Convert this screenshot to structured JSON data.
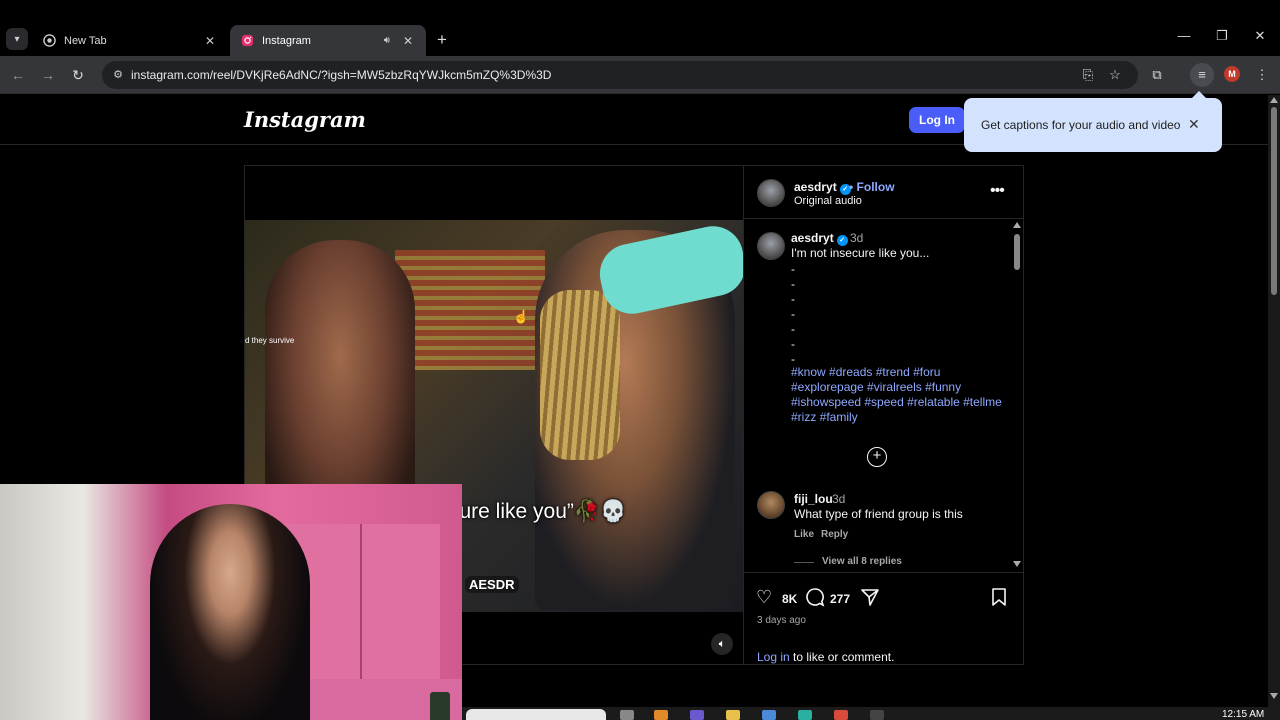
{
  "browser": {
    "tabs": [
      {
        "title": "New Tab",
        "icon": "chrome-icon",
        "active": false
      },
      {
        "title": "Instagram",
        "icon": "instagram-icon",
        "active": true
      }
    ],
    "url": "instagram.com/reel/DVKjRe6AdNC/?igsh=MW5zbzRqYWJkcm5mZQ%3D%3D",
    "profile_initial": "M",
    "profile_color": "#c0392b"
  },
  "captions_popup": {
    "message": "Get captions for your audio and video"
  },
  "instagram": {
    "logo": "Instagram",
    "login_button": "Log In",
    "accent": "#4a5df9"
  },
  "video": {
    "small_caption": "d they survive",
    "subtitle": "“Not Insecure like you”🥀💀",
    "watermark": "AESDR"
  },
  "post": {
    "username": "aesdryt",
    "follow": "Follow",
    "audio": "Original audio",
    "caption": {
      "username": "aesdryt",
      "age": "3d",
      "text": "I'm not insecure like you...",
      "dashes": [
        "-",
        "-",
        "-",
        "-",
        "-",
        "-",
        "-"
      ],
      "hashtags": "#know #dreads #trend #foru #explorepage #viralreels #funny #ishowspeed #speed #relatable #tellme #rizz #family"
    },
    "comment": {
      "username": "fiji_lou",
      "age": "3d",
      "text": "What type of friend group is this",
      "like": "Like",
      "reply": "Reply",
      "view_replies": "View all 8 replies"
    },
    "likes": "8K",
    "comments_count": "277",
    "posted": "3 days ago",
    "login_link": "Log in",
    "login_suffix": " to like or comment."
  },
  "taskbar": {
    "clock": "12:15 AM"
  }
}
